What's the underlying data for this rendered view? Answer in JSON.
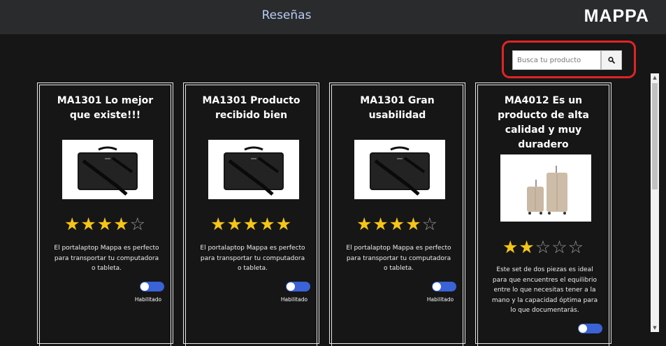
{
  "header": {
    "title": "Reseñas",
    "brand": "MAPPA"
  },
  "search": {
    "placeholder": "Busca tu producto",
    "icon": "search-icon"
  },
  "colors": {
    "accent": "#3b62d6",
    "star": "#f5c518",
    "highlight": "#e02424",
    "title": "#b9cdf2"
  },
  "reviews": [
    {
      "title": "MA1301 Lo mejor que existe!!!",
      "rating": 4,
      "max_rating": 5,
      "description": "El portalaptop Mappa es perfecto para transportar tu computadora o tableta.",
      "toggle_label": "Habilitado",
      "enabled": true,
      "image": "laptop-bag"
    },
    {
      "title": "MA1301 Producto recibido bien",
      "rating": 5,
      "max_rating": 5,
      "description": "El portalaptop Mappa es perfecto para transportar tu computadora o tableta.",
      "toggle_label": "Habilitado",
      "enabled": true,
      "image": "laptop-bag"
    },
    {
      "title": "MA1301 Gran usabilidad",
      "rating": 4,
      "max_rating": 5,
      "description": "El portalaptop Mappa es perfecto para transportar tu computadora o tableta.",
      "toggle_label": "Habilitado",
      "enabled": true,
      "image": "laptop-bag"
    },
    {
      "title": "MA4012 Es un producto de alta calidad y muy duradero",
      "rating": 2,
      "max_rating": 5,
      "description": "Este set de dos piezas es ideal para que encuentres el equilibrio entre lo que necesitas tener a la mano y la capacidad óptima para lo que documentarás.",
      "toggle_label": "",
      "enabled": true,
      "image": "luggage-set"
    }
  ]
}
